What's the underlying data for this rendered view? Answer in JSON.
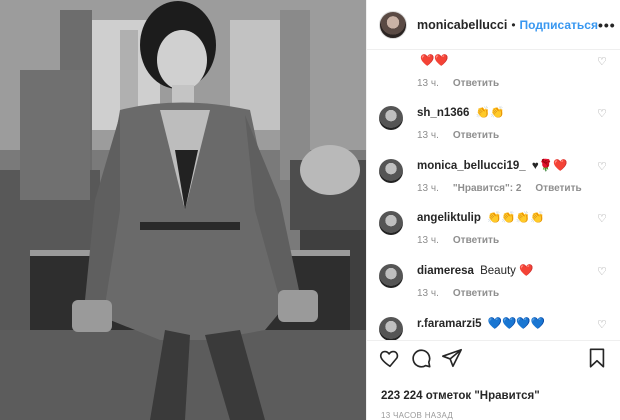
{
  "header": {
    "username": "monicabellucci",
    "separator": "•",
    "follow_label": "Подписаться",
    "more_label": "•••"
  },
  "comments": [
    {
      "user": "",
      "text": "❤️❤️",
      "time": "13 ч.",
      "likes": "",
      "reply": "Ответить"
    },
    {
      "user": "sh_n1366",
      "text": "👏👏",
      "time": "13 ч.",
      "likes": "",
      "reply": "Ответить"
    },
    {
      "user": "monica_bellucci19_",
      "text": "♥🌹❤️",
      "time": "13 ч.",
      "likes": "\"Нравится\": 2",
      "reply": "Ответить"
    },
    {
      "user": "angeliktulip",
      "text": "👏👏👏👏",
      "time": "13 ч.",
      "likes": "",
      "reply": "Ответить"
    },
    {
      "user": "diameresa",
      "text": "Beauty ❤️",
      "time": "13 ч.",
      "likes": "",
      "reply": "Ответить"
    },
    {
      "user": "r.faramarzi5",
      "text": "💙💙💙💙",
      "time": "",
      "likes": "",
      "reply": ""
    }
  ],
  "post": {
    "likes_text": "223 224 отметок \"Нравится\"",
    "time_ago": "13 ЧАСОВ НАЗАД"
  },
  "icons": {
    "like": "heart-outline-icon",
    "comment": "speech-bubble-icon",
    "share": "paper-plane-icon",
    "save": "bookmark-icon",
    "comment_like": "heart-outline-small-icon"
  }
}
